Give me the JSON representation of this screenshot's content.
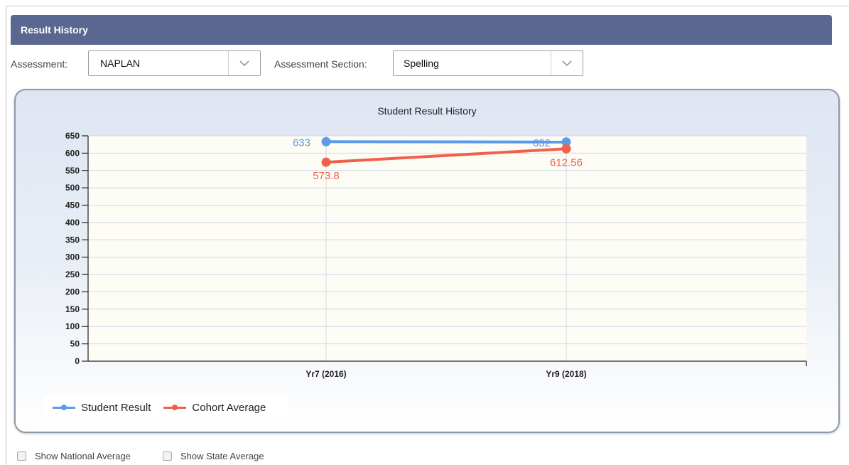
{
  "panel": {
    "title": "Result History"
  },
  "filters": {
    "assessment_label": "Assessment:",
    "assessment_value": "NAPLAN",
    "section_label": "Assessment Section:",
    "section_value": "Spelling"
  },
  "checkboxes": {
    "national": "Show National Average",
    "state": "Show State Average"
  },
  "colors": {
    "student": "#5b9bea",
    "cohort": "#f0604a",
    "header": "#5a6791"
  },
  "chart_data": {
    "type": "line",
    "title": "Student Result History",
    "categories": [
      "Yr7 (2016)",
      "Yr9 (2018)"
    ],
    "series": [
      {
        "name": "Student Result",
        "values": [
          633,
          632
        ],
        "labels": [
          "633",
          "632"
        ]
      },
      {
        "name": "Cohort Average",
        "values": [
          573.8,
          612.56
        ],
        "labels": [
          "573.8",
          "612.56"
        ]
      }
    ],
    "y_ticks": [
      0,
      50,
      100,
      150,
      200,
      250,
      300,
      350,
      400,
      450,
      500,
      550,
      600,
      650
    ],
    "ylim": [
      0,
      650
    ],
    "grid": true,
    "legend_position": "bottom-left"
  }
}
